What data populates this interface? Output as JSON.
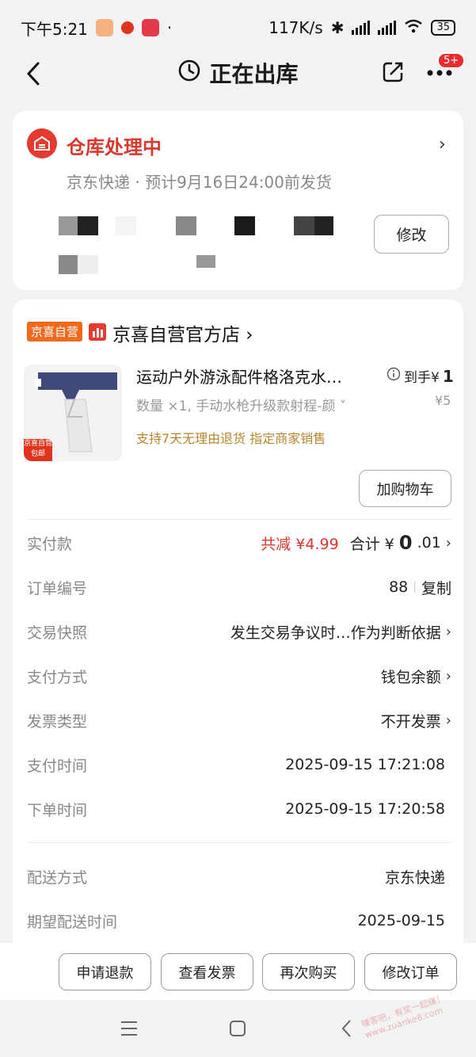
{
  "status_bar": {
    "time": "下午5:21",
    "speed": "117K/s",
    "battery": "35"
  },
  "nav": {
    "title": "正在出库",
    "badge": "5+"
  },
  "warehouse": {
    "title": "仓库处理中",
    "subtitle": "京东快递 · 预计9月16日24:00前发货",
    "modify_label": "修改"
  },
  "store": {
    "tag": "京喜自营",
    "name": "京喜自营官方店 ›"
  },
  "product": {
    "title": "运动户外游泳配件格洛克水…",
    "spec": "数量 ×1, 手动水枪升级款射程-颜 ˅",
    "tags": "支持7天无理由退货   指定商家销售",
    "price_label": "到手¥",
    "price_value": "1",
    "original_price": "¥5",
    "cart_label": "加购物车",
    "img_tag_top": "京喜自营",
    "img_tag_bottom": "包邮"
  },
  "summary": {
    "label": "实付款",
    "discount": "共减 ¥4.99",
    "total_prefix": "合计 ¥",
    "total_int": "0",
    "total_dec": ".01"
  },
  "rows": [
    {
      "label": "订单编号",
      "value": "88",
      "extra": "复制"
    },
    {
      "label": "交易快照",
      "value": "发生交易争议时…作为判断依据"
    },
    {
      "label": "支付方式",
      "value": "钱包余额"
    },
    {
      "label": "发票类型",
      "value": "不开发票"
    },
    {
      "label": "支付时间",
      "value": "2025-09-15 17:21:08"
    },
    {
      "label": "下单时间",
      "value": "2025-09-15 17:20:58"
    },
    {
      "label": "配送方式",
      "value": "京东快递"
    },
    {
      "label": "期望配送时间",
      "value": "2025-09-15"
    }
  ],
  "actions": [
    "申请退款",
    "查看发票",
    "再次购买",
    "修改订单"
  ],
  "watermark": "赚客吧，有奖一起赚！ www.zuanke8.com",
  "colors": {
    "accent_red": "#d9382e",
    "tag_orange": "#f06a1e",
    "tag_gold": "#b5862d"
  }
}
